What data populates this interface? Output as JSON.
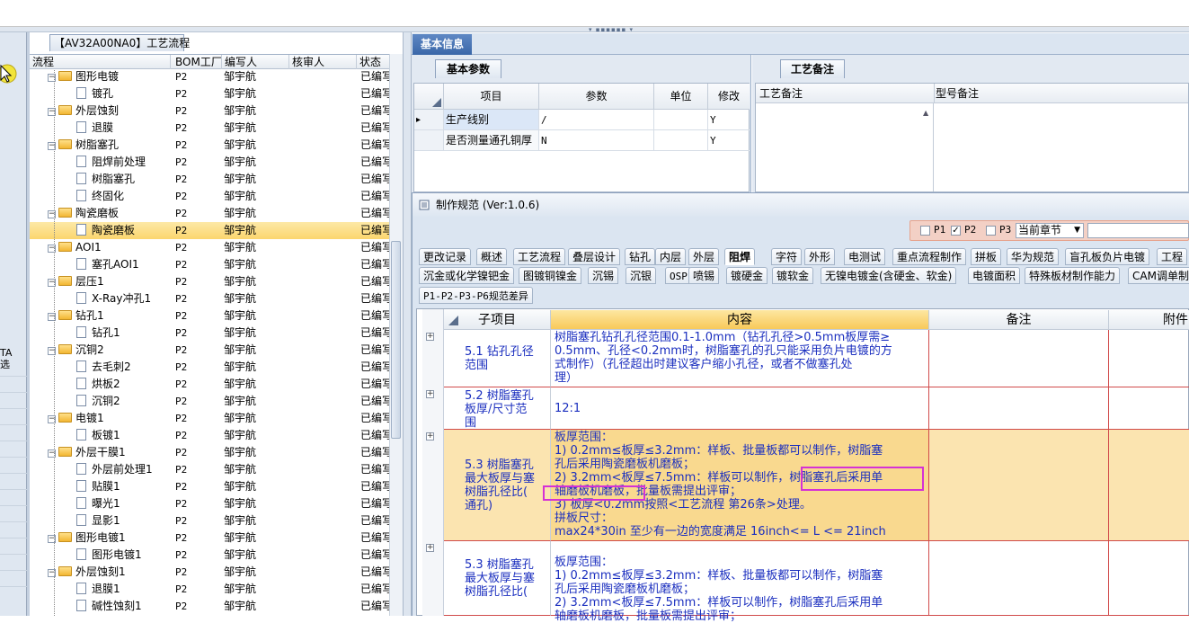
{
  "tree_panel": {
    "tab_title": "【AV32A00NA0】工艺流程",
    "columns": [
      "流程",
      "BOM工厂",
      "编写人",
      "核审人",
      "状态"
    ],
    "side_label": "TA\n选",
    "rows": [
      {
        "name": "图形电镀",
        "level": 1,
        "folder": true,
        "bom": "P2",
        "writer": "邹宇航",
        "status": "已编写"
      },
      {
        "name": "镀孔",
        "level": 2,
        "folder": false,
        "bom": "P2",
        "writer": "邹宇航",
        "status": "已编写"
      },
      {
        "name": "外层蚀刻",
        "level": 1,
        "folder": true,
        "bom": "P2",
        "writer": "邹宇航",
        "status": "已编写"
      },
      {
        "name": "退膜",
        "level": 2,
        "folder": false,
        "bom": "P2",
        "writer": "邹宇航",
        "status": "已编写"
      },
      {
        "name": "树脂塞孔",
        "level": 1,
        "folder": true,
        "bom": "P2",
        "writer": "邹宇航",
        "status": "已编写"
      },
      {
        "name": "阻焊前处理",
        "level": 2,
        "folder": false,
        "bom": "P2",
        "writer": "邹宇航",
        "status": "已编写"
      },
      {
        "name": "树脂塞孔",
        "level": 2,
        "folder": false,
        "bom": "P2",
        "writer": "邹宇航",
        "status": "已编写"
      },
      {
        "name": "终固化",
        "level": 2,
        "folder": false,
        "bom": "P2",
        "writer": "邹宇航",
        "status": "已编写"
      },
      {
        "name": "陶瓷磨板",
        "level": 1,
        "folder": true,
        "bom": "P2",
        "writer": "邹宇航",
        "status": "已编写"
      },
      {
        "name": "陶瓷磨板",
        "level": 2,
        "folder": false,
        "bom": "P2",
        "writer": "邹宇航",
        "status": "已编写",
        "selected": true
      },
      {
        "name": "AOI1",
        "level": 1,
        "folder": true,
        "bom": "P2",
        "writer": "邹宇航",
        "status": "已编写"
      },
      {
        "name": "塞孔AOI1",
        "level": 2,
        "folder": false,
        "bom": "P2",
        "writer": "邹宇航",
        "status": "已编写"
      },
      {
        "name": "层压1",
        "level": 1,
        "folder": true,
        "bom": "P2",
        "writer": "邹宇航",
        "status": "已编写"
      },
      {
        "name": "X-Ray冲孔1",
        "level": 2,
        "folder": false,
        "bom": "P2",
        "writer": "邹宇航",
        "status": "已编写"
      },
      {
        "name": "钻孔1",
        "level": 1,
        "folder": true,
        "bom": "P2",
        "writer": "邹宇航",
        "status": "已编写"
      },
      {
        "name": "钻孔1",
        "level": 2,
        "folder": false,
        "bom": "P2",
        "writer": "邹宇航",
        "status": "已编写"
      },
      {
        "name": "沉铜2",
        "level": 1,
        "folder": true,
        "bom": "P2",
        "writer": "邹宇航",
        "status": "已编写"
      },
      {
        "name": "去毛刺2",
        "level": 2,
        "folder": false,
        "bom": "P2",
        "writer": "邹宇航",
        "status": "已编写"
      },
      {
        "name": "烘板2",
        "level": 2,
        "folder": false,
        "bom": "P2",
        "writer": "邹宇航",
        "status": "已编写"
      },
      {
        "name": "沉铜2",
        "level": 2,
        "folder": false,
        "bom": "P2",
        "writer": "邹宇航",
        "status": "已编写"
      },
      {
        "name": "电镀1",
        "level": 1,
        "folder": true,
        "bom": "P2",
        "writer": "邹宇航",
        "status": "已编写"
      },
      {
        "name": "板镀1",
        "level": 2,
        "folder": false,
        "bom": "P2",
        "writer": "邹宇航",
        "status": "已编写"
      },
      {
        "name": "外层干膜1",
        "level": 1,
        "folder": true,
        "bom": "P2",
        "writer": "邹宇航",
        "status": "已编写"
      },
      {
        "name": "外层前处理1",
        "level": 2,
        "folder": false,
        "bom": "P2",
        "writer": "邹宇航",
        "status": "已编写"
      },
      {
        "name": "贴膜1",
        "level": 2,
        "folder": false,
        "bom": "P2",
        "writer": "邹宇航",
        "status": "已编写"
      },
      {
        "name": "曝光1",
        "level": 2,
        "folder": false,
        "bom": "P2",
        "writer": "邹宇航",
        "status": "已编写"
      },
      {
        "name": "显影1",
        "level": 2,
        "folder": false,
        "bom": "P2",
        "writer": "邹宇航",
        "status": "已编写"
      },
      {
        "name": "图形电镀1",
        "level": 1,
        "folder": true,
        "bom": "P2",
        "writer": "邹宇航",
        "status": "已编写"
      },
      {
        "name": "图形电镀1",
        "level": 2,
        "folder": false,
        "bom": "P2",
        "writer": "邹宇航",
        "status": "已编写"
      },
      {
        "name": "外层蚀刻1",
        "level": 1,
        "folder": true,
        "bom": "P2",
        "writer": "邹宇航",
        "status": "已编写"
      },
      {
        "name": "退膜1",
        "level": 2,
        "folder": false,
        "bom": "P2",
        "writer": "邹宇航",
        "status": "已编写"
      },
      {
        "name": "碱性蚀刻1",
        "level": 2,
        "folder": false,
        "bom": "P2",
        "writer": "邹宇航",
        "status": "已编写"
      }
    ]
  },
  "basic_info": {
    "title": "基本信息",
    "params_tab": "基本参数",
    "params_columns": [
      "项目",
      "参数",
      "单位",
      "修改"
    ],
    "params_rows": [
      {
        "item": "生产线别",
        "value": "/",
        "unit": "",
        "modify": "Y",
        "current": true
      },
      {
        "item": "是否测量通孔铜厚",
        "value": "N",
        "unit": "",
        "modify": "Y",
        "current": false
      }
    ],
    "notes_tab": "工艺备注",
    "notes_columns": [
      "工艺备注",
      "型号备注"
    ]
  },
  "spec_dialog": {
    "title": "制作规范 (Ver:1.0.6)",
    "filters": {
      "p1": "P1",
      "p2": "P2",
      "p3": "P3",
      "p1_checked": false,
      "p2_checked": true,
      "p3_checked": false,
      "chapter": "当前章节"
    },
    "tabs_row1": [
      "更改记录",
      "概述",
      "工艺流程",
      "叠层设计",
      "钻孔",
      "内层",
      "外层",
      "阻焊",
      "字符",
      "外形",
      "电测试",
      "重点流程制作",
      "拼板",
      "华为规范",
      "盲孔板负片电镀",
      "工程"
    ],
    "tabs_row2": [
      "沉金或化学镍钯金",
      "图镀铜镍金",
      "沉锡",
      "沉银",
      "OSP",
      "喷锡",
      "镀硬金",
      "镀软金",
      "无镍电镀金(含硬金、软金)",
      "电镀面积",
      "特殊板材制作能力",
      "CAM调单制作"
    ],
    "tabs_row3": [
      "P1-P2-P3-P6规范差异"
    ],
    "active_tab": "阻焊",
    "columns": {
      "sub": "子项目",
      "content": "内容",
      "note": "备注",
      "attach": "附件"
    },
    "rows": [
      {
        "sub": [
          "5.1 钻孔孔径",
          "范围"
        ],
        "content": [
          "树脂塞孔钻孔孔径范围0.1-1.0mm（钻孔孔径>0.5mm板厚需≥",
          "0.5mm、孔径<0.2mm时，树脂塞孔的孔只能采用负片电镀的方",
          "式制作）（孔径超出时建议客户缩小孔径，或者不做塞孔处",
          "理）"
        ]
      },
      {
        "sub": [
          "5.2 树脂塞孔",
          "板厚/尺寸范",
          "围"
        ],
        "content": [
          "12:1"
        ]
      },
      {
        "sub": [
          "5.3 树脂塞孔",
          "最大板厚与塞",
          "树脂孔径比(",
          "通孔)"
        ],
        "content": [
          "板厚范围：",
          "1) 0.2mm≤板厚≤3.2mm：样板、批量板都可以制作，树脂塞",
          "孔后采用陶瓷磨板机磨板；",
          "2) 3.2mm<板厚≤7.5mm：样板可以制作，树脂塞孔后采用单",
          "轴磨板机磨板，批量板需提出评审；",
          "3) 板厚<0.2mm按照<工艺流程  第26条>处理。",
          "拼板尺寸：",
          "max24*30in 至少有一边的宽度满足 16inch<= L <= 21inch"
        ]
      },
      {
        "sub": [
          "5.3 树脂塞孔",
          "最大板厚与塞",
          "树脂孔径比("
        ],
        "content": [
          "板厚范围：",
          "1) 0.2mm≤板厚≤3.2mm：样板、批量板都可以制作，树脂塞",
          "孔后采用陶瓷磨板机磨板；",
          "2) 3.2mm<板厚≤7.5mm：样板可以制作，树脂塞孔后采用单",
          "轴磨板机磨板，批量板需提出评审；"
        ]
      }
    ]
  }
}
